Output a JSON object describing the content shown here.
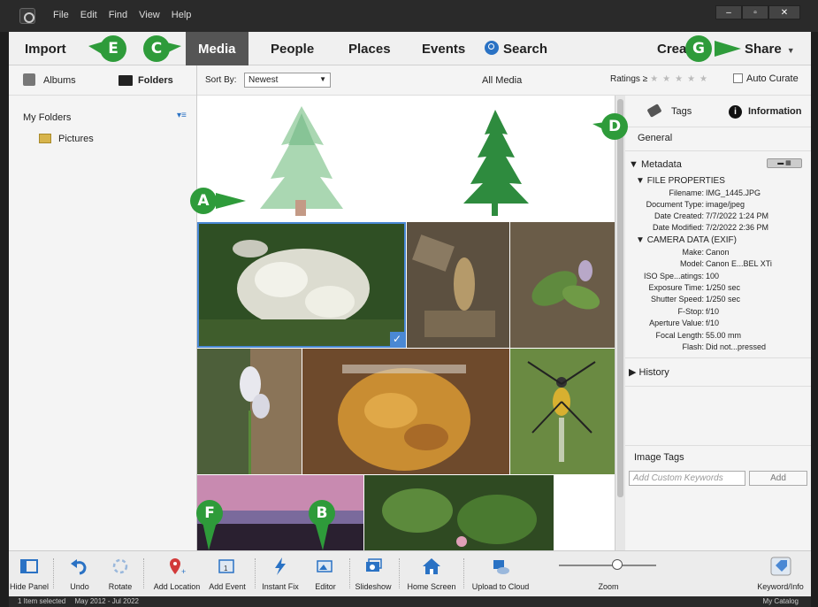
{
  "menu": [
    "File",
    "Edit",
    "Find",
    "View",
    "Help"
  ],
  "window_controls": {
    "minimize": "–",
    "maximize": "▫",
    "close": "✕"
  },
  "topnav": {
    "import": "Import",
    "media": "Media",
    "people": "People",
    "places": "Places",
    "events": "Events",
    "search": "Search",
    "create": "Crea",
    "share": "Share"
  },
  "left_panel": {
    "albums": "Albums",
    "folders": "Folders",
    "my_folders": "My Folders",
    "folder_items": [
      "Pictures"
    ]
  },
  "view_toolbar": {
    "sort_by_label": "Sort By:",
    "sort_by_value": "Newest",
    "view_title": "All Media",
    "ratings_label": "Ratings ≥",
    "stars": "★★★★★",
    "auto_curate": "Auto Curate"
  },
  "right_panel": {
    "tabs": {
      "tags": "Tags",
      "information": "Information"
    },
    "general": "General",
    "metadata": "Metadata",
    "file_properties": "FILE PROPERTIES",
    "file_props": [
      {
        "k": "Filename:",
        "v": "IMG_1445.JPG"
      },
      {
        "k": "Document Type:",
        "v": "image/jpeg"
      },
      {
        "k": "Date Created:",
        "v": "7/7/2022 1:24 PM"
      },
      {
        "k": "Date Modified:",
        "v": "7/2/2022 2:36 PM"
      }
    ],
    "camera_data": "CAMERA DATA (EXIF)",
    "camera_props": [
      {
        "k": "Make:",
        "v": "Canon"
      },
      {
        "k": "Model:",
        "v": "Canon E...BEL XTi"
      },
      {
        "k": "ISO Spe...atings:",
        "v": "100"
      },
      {
        "k": "Exposure Time:",
        "v": "1/250 sec"
      },
      {
        "k": "Shutter Speed:",
        "v": "1/250 sec"
      },
      {
        "k": "F-Stop:",
        "v": "f/10"
      },
      {
        "k": "Aperture Value:",
        "v": "f/10"
      },
      {
        "k": "Focal Length:",
        "v": "55.00 mm"
      },
      {
        "k": "Flash:",
        "v": "Did not...pressed"
      }
    ],
    "history": "History",
    "image_tags": "Image Tags",
    "keyword_placeholder": "Add Custom Keywords",
    "add": "Add"
  },
  "bottom_toolbar": {
    "hide_panel": "Hide Panel",
    "undo": "Undo",
    "rotate": "Rotate",
    "add_location": "Add Location",
    "add_event": "Add Event",
    "instant_fix": "Instant Fix",
    "editor": "Editor",
    "slideshow": "Slideshow",
    "home_screen": "Home Screen",
    "upload_to_cloud": "Upload to Cloud",
    "zoom": "Zoom",
    "keyword_info": "Keyword/Info"
  },
  "status": {
    "selected": "1 Item selected",
    "range": "May 2012 - Jul 2022",
    "catalog": "My Catalog"
  },
  "callouts": {
    "a": "A",
    "b": "B",
    "c": "C",
    "d": "D",
    "e": "E",
    "f": "F",
    "g": "G"
  },
  "colors": {
    "callout": "#2e9b3a",
    "selection": "#4a88d4",
    "accent": "#2a72c4"
  }
}
